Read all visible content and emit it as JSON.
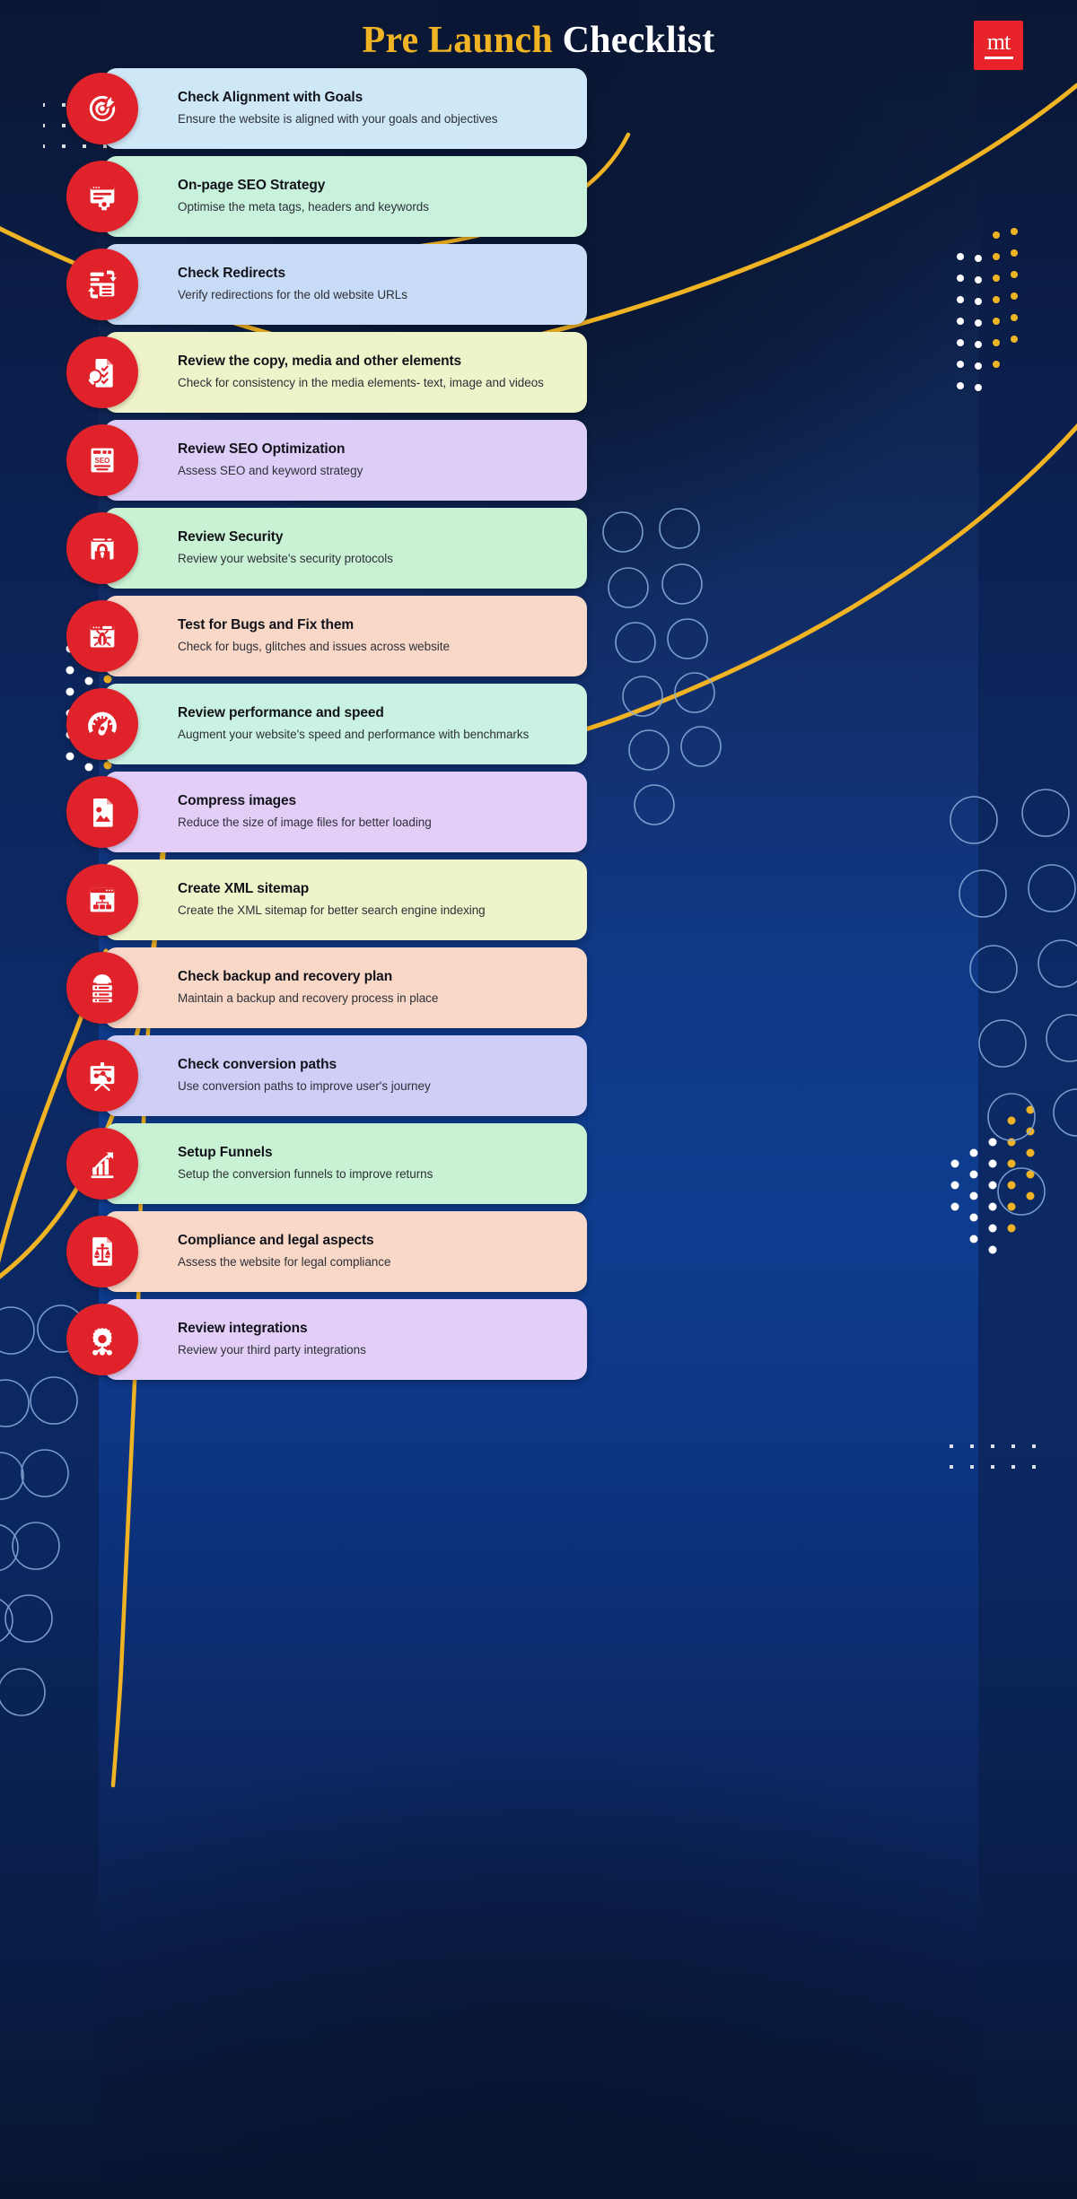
{
  "header": {
    "title_accent": "Pre Launch",
    "title_plain": "Checklist",
    "logo_mark": "mt",
    "logo_bg": "#e8242a",
    "accent_color": "#f0b323"
  },
  "theme": {
    "background_dark": "#0a1734",
    "background_mid": "#0e3c8e",
    "icon_circle_color": "#e0232a",
    "connector_color": "#f0b323",
    "dot_white": "#ffffff",
    "dot_yellow": "#f0b323",
    "circle_outline": "#7fa8d8"
  },
  "checklist": {
    "items": [
      {
        "title": "Check Alignment with Goals",
        "desc": "Ensure the website is aligned with your goals and objectives",
        "bg": "#cfe8f7",
        "icon": "target-icon"
      },
      {
        "title": "On-page SEO Strategy",
        "desc": "Optimise the meta tags, headers and keywords",
        "bg": "#c9f2dd",
        "icon": "browser-gear-icon"
      },
      {
        "title": "Check Redirects",
        "desc": "Verify redirections for the old website URLs",
        "bg": "#c9dcf7",
        "icon": "redirect-arrows-icon"
      },
      {
        "title": "Review the copy, media and other elements",
        "desc": "Check for consistency in the media elements- text, image and videos",
        "bg": "#eff3c9",
        "icon": "document-magnifier-icon"
      },
      {
        "title": "Review SEO Optimization",
        "desc": "Assess SEO and keyword strategy",
        "bg": "#ddcef7",
        "icon": "seo-page-icon"
      },
      {
        "title": "Review Security",
        "desc": "Review your website's security protocols",
        "bg": "#c9f2d4",
        "icon": "lock-browser-icon"
      },
      {
        "title": "Test for Bugs and Fix them",
        "desc": "Check for bugs, glitches and issues across website",
        "bg": "#f9d8c8",
        "icon": "bug-browser-icon"
      },
      {
        "title": "Review performance and speed",
        "desc": "Augment your website's speed and performance with benchmarks",
        "bg": "#c9f2e2",
        "icon": "speedometer-icon"
      },
      {
        "title": "Compress images",
        "desc": "Reduce the size of image files for better loading",
        "bg": "#e2cef7",
        "icon": "image-file-icon"
      },
      {
        "title": "Create XML sitemap",
        "desc": "Create the XML sitemap for better search engine indexing",
        "bg": "#eff3c9",
        "icon": "sitemap-icon"
      },
      {
        "title": "Check backup and recovery plan",
        "desc": "Maintain a backup and recovery process in place",
        "bg": "#f9d8c8",
        "icon": "backup-server-icon"
      },
      {
        "title": "Check conversion paths",
        "desc": "Use conversion paths to improve user's journey",
        "bg": "#cfcef7",
        "icon": "conversion-board-icon"
      },
      {
        "title": "Setup Funnels",
        "desc": "Setup the conversion funnels to improve returns",
        "bg": "#c9f2d4",
        "icon": "bar-growth-icon"
      },
      {
        "title": "Compliance and legal aspects",
        "desc": "Assess the website for legal compliance",
        "bg": "#f9d8c8",
        "icon": "legal-scales-icon"
      },
      {
        "title": "Review integrations",
        "desc": "Review your third party integrations",
        "bg": "#e2cef7",
        "icon": "gear-network-icon"
      }
    ]
  }
}
